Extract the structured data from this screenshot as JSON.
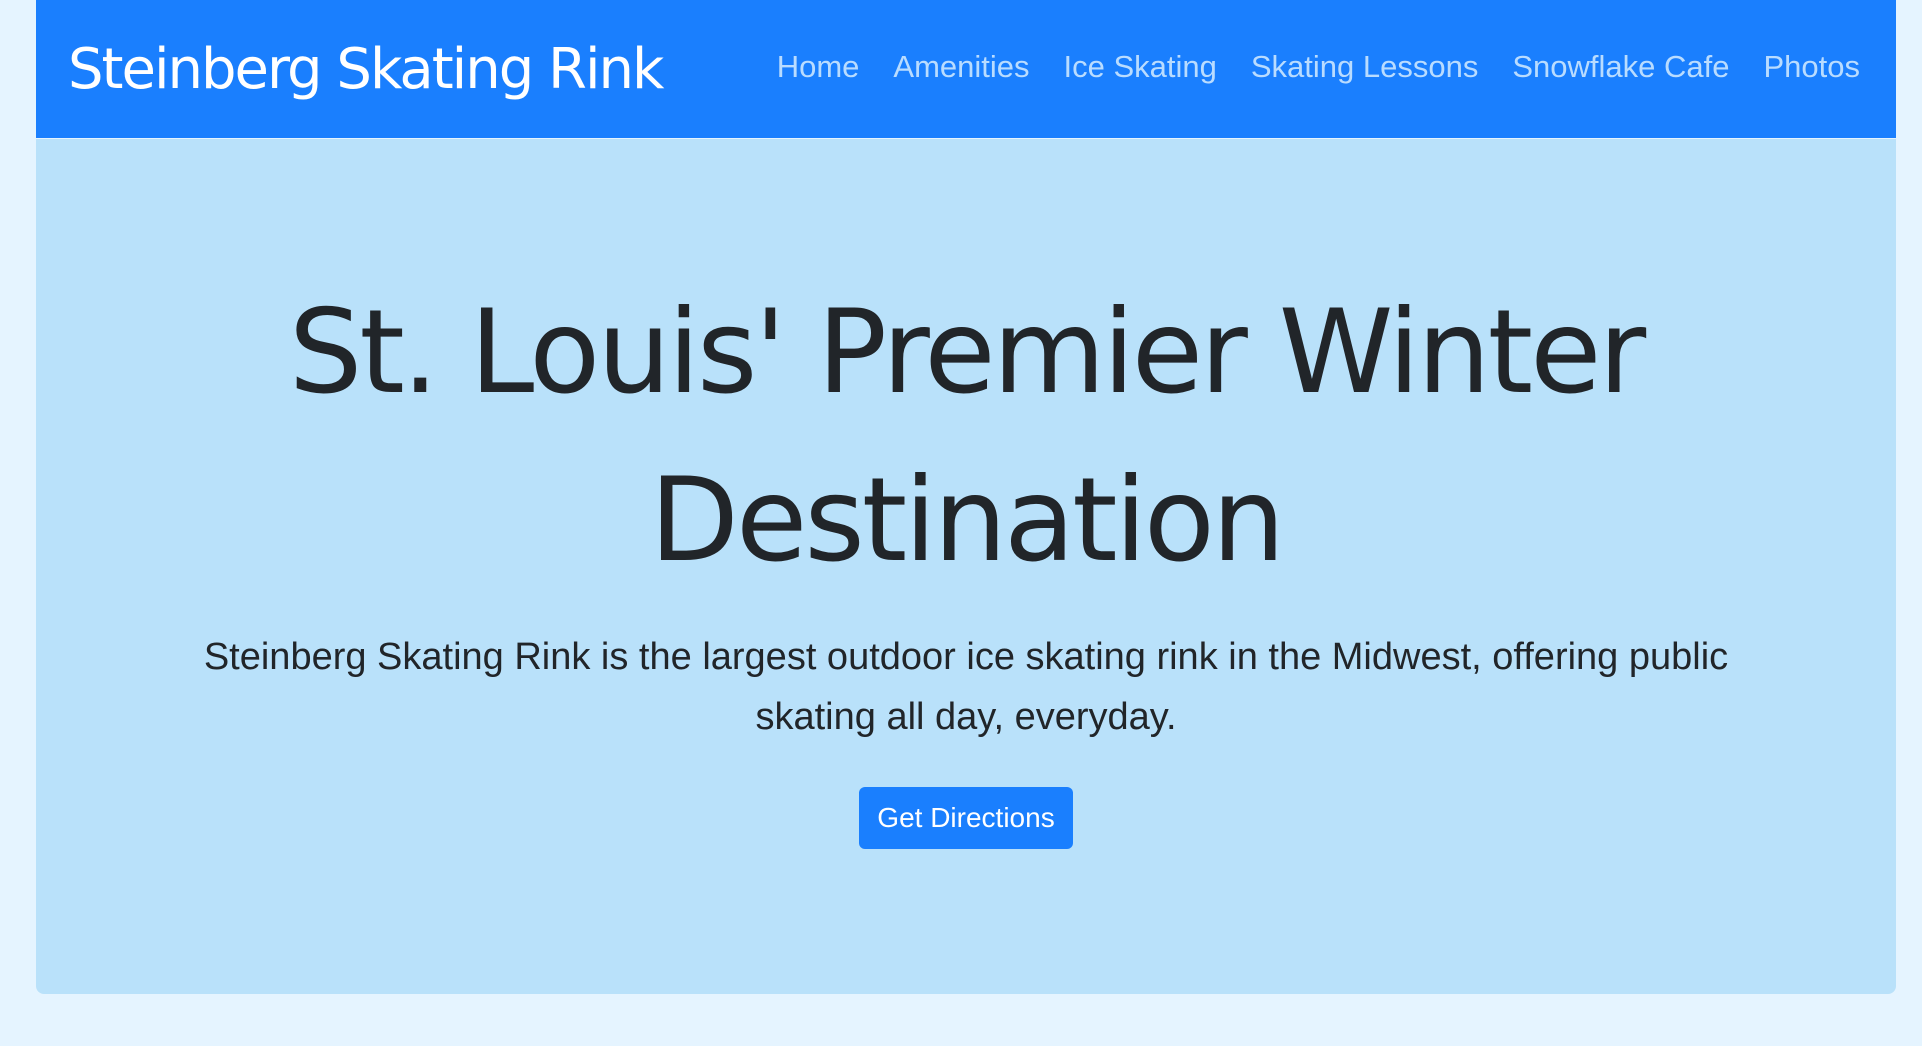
{
  "navbar": {
    "brand": "Steinberg Skating Rink",
    "links": [
      {
        "label": "Home"
      },
      {
        "label": "Amenities"
      },
      {
        "label": "Ice Skating"
      },
      {
        "label": "Skating Lessons"
      },
      {
        "label": "Snowflake Cafe"
      },
      {
        "label": "Photos"
      }
    ]
  },
  "hero": {
    "title": "St. Louis' Premier Winter Destination",
    "description": "Steinberg Skating Rink is the largest outdoor ice skating rink in the Midwest, offering public skating all day, everyday.",
    "cta_label": "Get Directions"
  },
  "colors": {
    "page_background": "#e5f4ff",
    "navbar_background": "#1a7ffe",
    "nav_link": "#b9dcff",
    "hero_background": "#b9e1fa",
    "text": "#212529",
    "button": "#1a7ffe"
  }
}
